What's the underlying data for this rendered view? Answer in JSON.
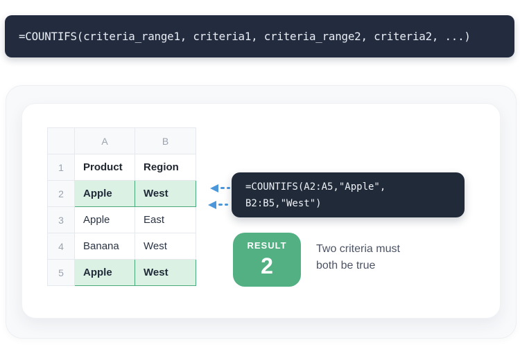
{
  "banner": {
    "formula": "=COUNTIFS(criteria_range1, criteria1, criteria_range2, criteria2, ...)"
  },
  "spreadsheet": {
    "column_headers": [
      "A",
      "B"
    ],
    "rows": [
      {
        "num": "1",
        "cells": [
          "Product",
          "Region"
        ],
        "style": "field-header"
      },
      {
        "num": "2",
        "cells": [
          "Apple",
          "West"
        ],
        "style": "highlight"
      },
      {
        "num": "3",
        "cells": [
          "Apple",
          "East"
        ],
        "style": "normal"
      },
      {
        "num": "4",
        "cells": [
          "Banana",
          "West"
        ],
        "style": "normal"
      },
      {
        "num": "5",
        "cells": [
          "Apple",
          "West"
        ],
        "style": "highlight"
      }
    ]
  },
  "tooltip": {
    "lines": [
      "=COUNTIFS(A2:A5,\"Apple\",",
      "B2:B5,\"West\")"
    ]
  },
  "result": {
    "label": "RESULT",
    "value": "2",
    "description_lines": [
      "Two criteria must",
      "both be true"
    ]
  },
  "colors": {
    "banner_bg": "#232c3e",
    "tooltip_bg": "#212a39",
    "accent_green": "#52b083",
    "highlight_bg": "#daf1e3",
    "highlight_border": "#49a97a",
    "arrow_blue": "#4b97da"
  }
}
